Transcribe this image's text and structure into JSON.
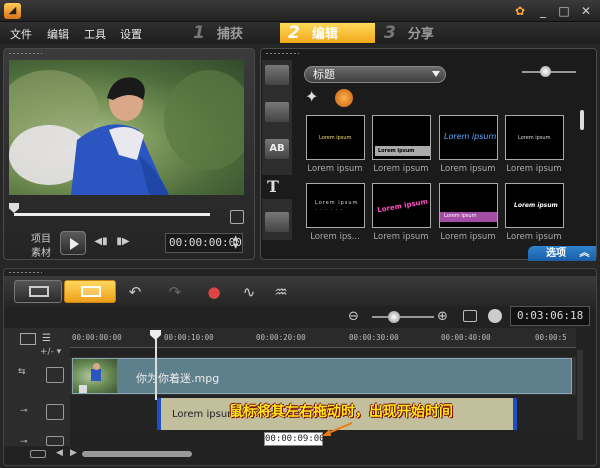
{
  "app": {
    "window_buttons": [
      "_",
      "□",
      "✕"
    ]
  },
  "menu": [
    "文件",
    "编辑",
    "工具",
    "设置"
  ],
  "steps": [
    {
      "num": "1",
      "label": "捕获"
    },
    {
      "num": "2",
      "label": "编辑"
    },
    {
      "num": "3",
      "label": "分享"
    }
  ],
  "preview": {
    "mode_project": "项目",
    "mode_clip": "素材",
    "timecode": "00:00:00:00"
  },
  "library": {
    "category": "标题",
    "options_label": "选项",
    "thumbnails": [
      {
        "label": "Lorem ipsum",
        "text": "Lorem ipsum"
      },
      {
        "label": "Lorem ipsum",
        "text": "Lorem ipsum"
      },
      {
        "label": "Lorem ipsum",
        "text": "Lorem ipsum"
      },
      {
        "label": "Lorem ipsum",
        "text": "Lorem ipsum"
      },
      {
        "label": "Lorem ips...",
        "text": "Lorem ipsum"
      },
      {
        "label": "Lorem ipsum",
        "text": "Lorem ipsum"
      },
      {
        "label": "Lorem ipsum",
        "text": "Lorem ipsum"
      },
      {
        "label": "Lorem ipsum",
        "text": "Lorem ipsum"
      }
    ]
  },
  "timeline": {
    "duration": "0:03:06:18",
    "ruler_ticks": [
      "00:00:00:00",
      "00:00:10:00",
      "00:00:20:00",
      "00:00:30:00",
      "00:00:40:00",
      "00:00:5"
    ],
    "video_clip": "你为你着迷.mpg",
    "title_clip": "Lorem ipsum",
    "annotation": "鼠标将其左右拖动时，出现开始时间",
    "start_time": "00:00:09:00",
    "colors": {
      "accent": "#f2a81a",
      "clip_video": "#5e7f8c",
      "clip_title": "#c2bf9d",
      "handle": "#1e4fc2"
    }
  }
}
